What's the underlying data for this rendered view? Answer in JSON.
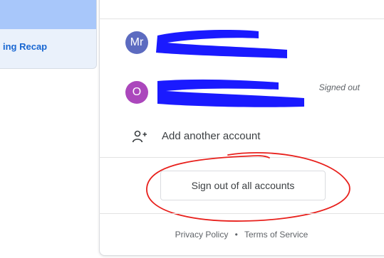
{
  "sidebar": {
    "item_label": "ing Recap"
  },
  "accounts": [
    {
      "avatar_initials": "Mr",
      "avatar_color": "#5c6bc0",
      "status": ""
    },
    {
      "avatar_initials": "O",
      "avatar_color": "#ab47bc",
      "status": "Signed out"
    }
  ],
  "actions": {
    "add_account_label": "Add another account",
    "sign_out_all_label": "Sign out of all accounts"
  },
  "footer": {
    "privacy_label": "Privacy Policy",
    "separator": "•",
    "terms_label": "Terms of Service"
  },
  "colors": {
    "redaction": "#1a1aff",
    "annotation": "#e8201c"
  }
}
